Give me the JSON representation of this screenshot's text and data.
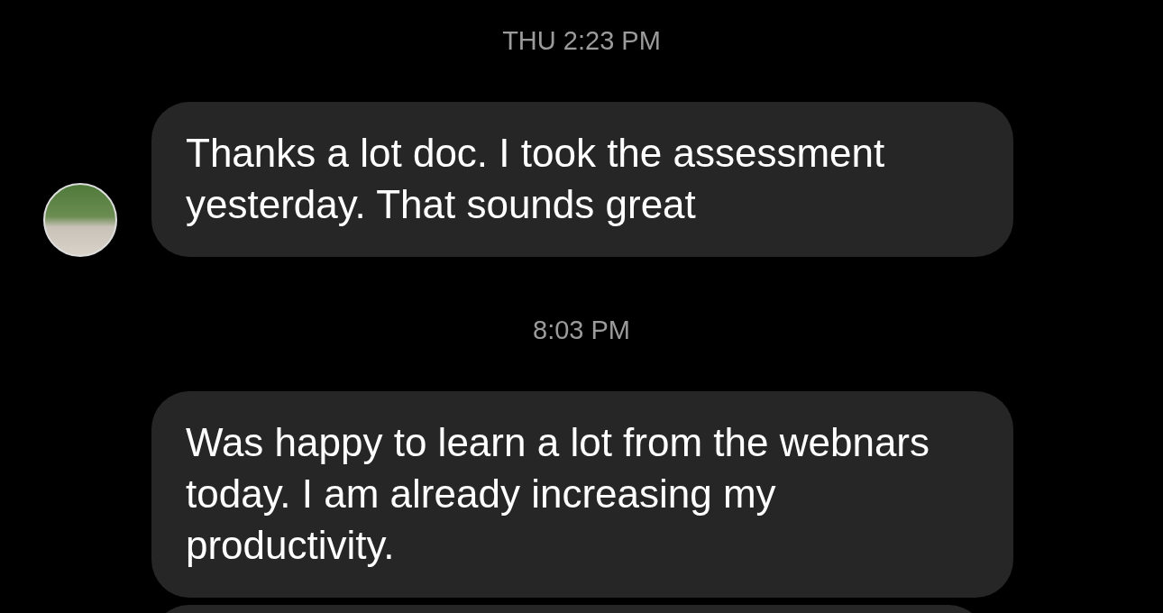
{
  "messages": [
    {
      "kind": "timestamp",
      "text": "THU 2:23 PM"
    },
    {
      "kind": "bubble",
      "text": "Thanks a lot doc. I took the assessment yesterday. That sounds great",
      "avatar": true
    },
    {
      "kind": "timestamp",
      "text": "8:03 PM"
    },
    {
      "kind": "bubble",
      "text": "Was happy to learn a lot from the webnars today. I am already increasing my productivity.",
      "avatar": false
    },
    {
      "kind": "partial",
      "avatar": false
    }
  ]
}
